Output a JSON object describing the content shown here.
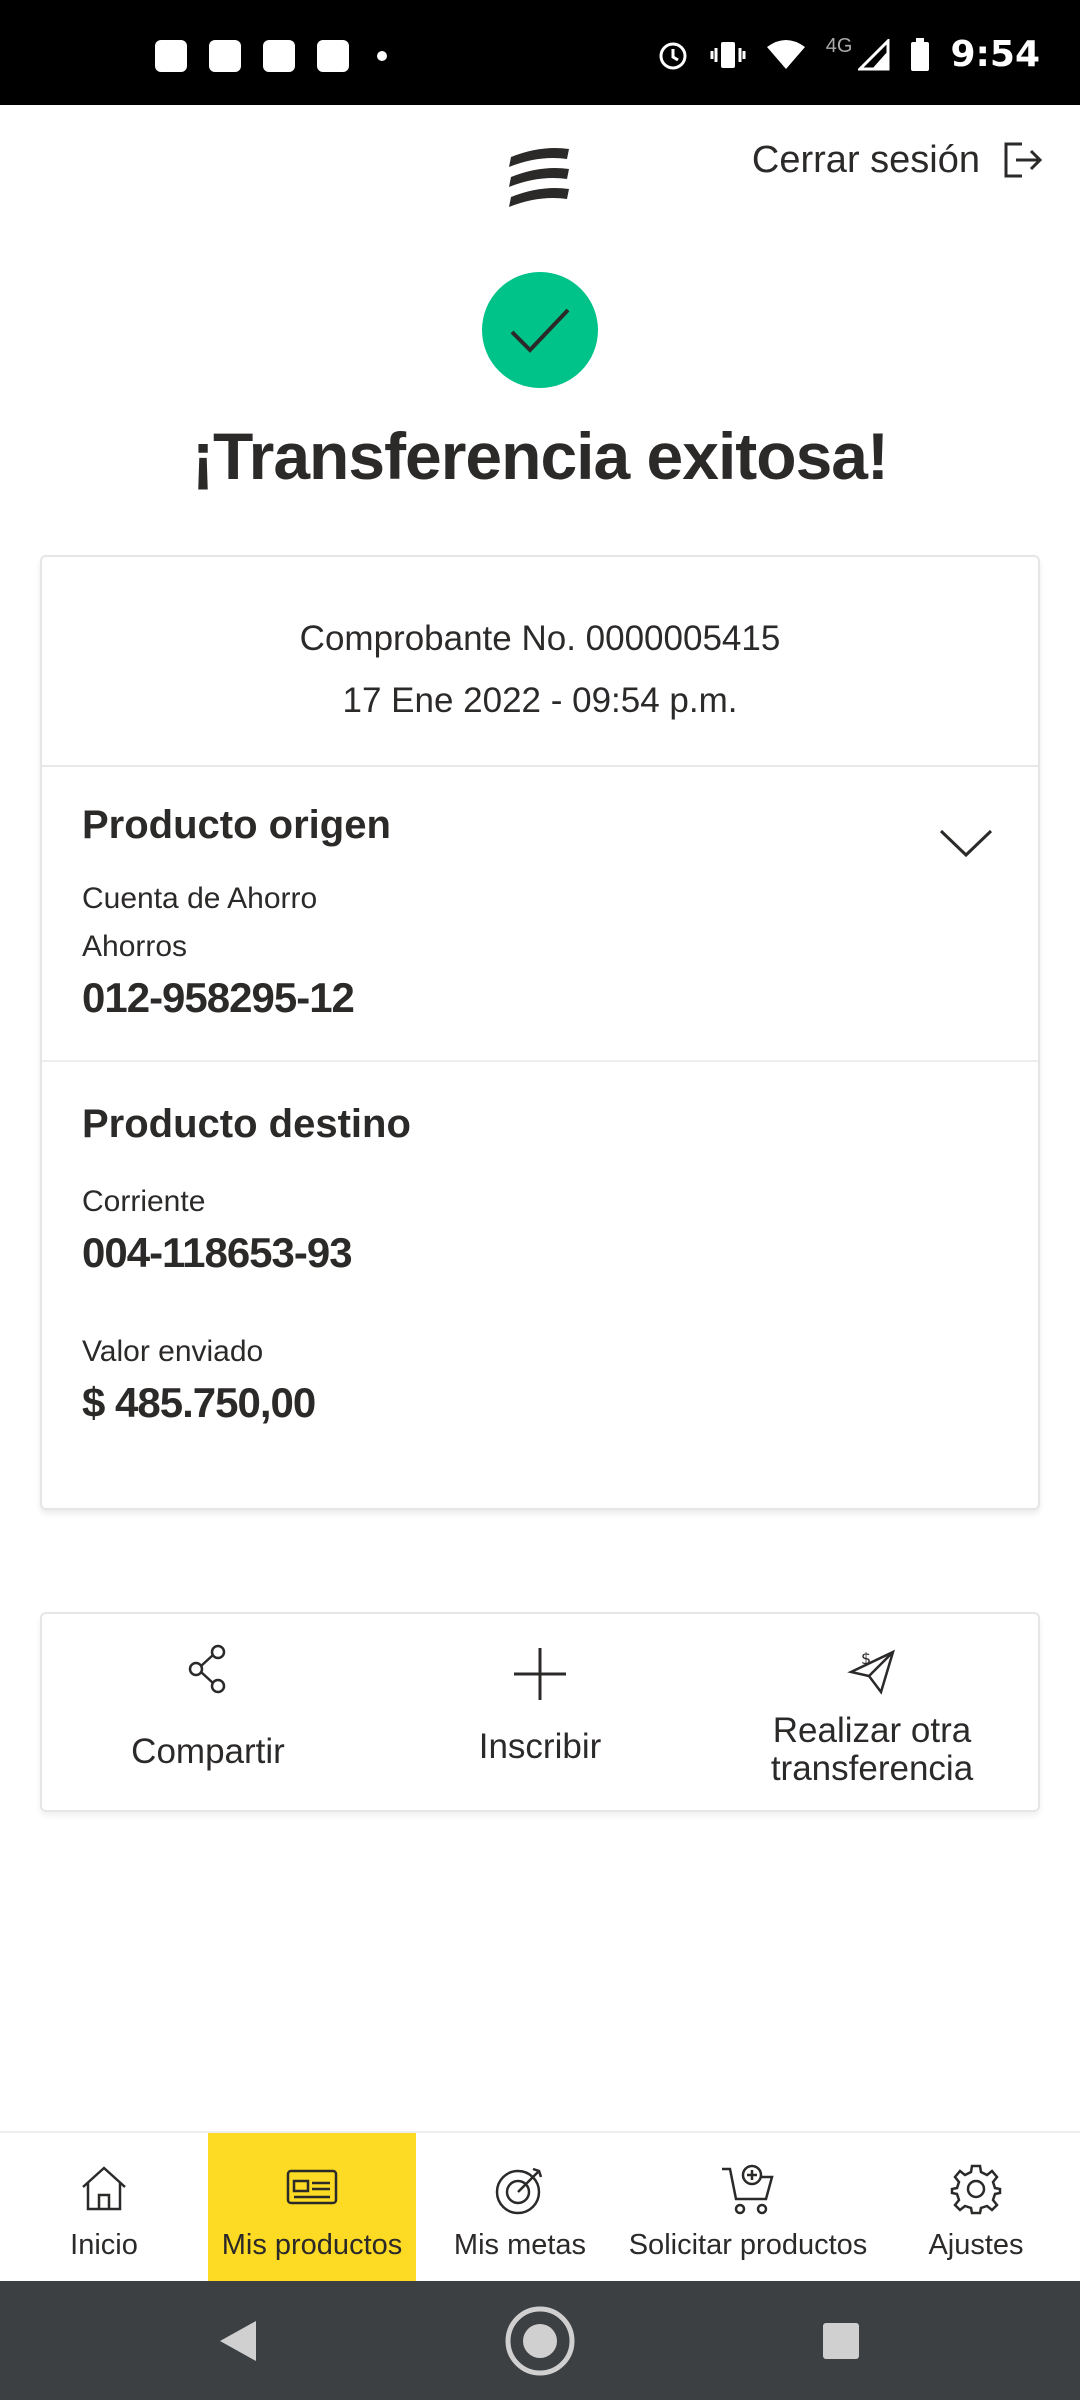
{
  "status_bar": {
    "time": "9:54",
    "network": "4G"
  },
  "header": {
    "logout_label": "Cerrar sesión"
  },
  "title": "¡Transferencia exitosa!",
  "receipt": {
    "number": "Comprobante No. 0000005415",
    "date": "17 Ene 2022 - 09:54 p.m."
  },
  "origin": {
    "heading": "Producto origen",
    "type": "Cuenta de Ahorro",
    "subtype": "Ahorros",
    "account": "012-958295-12"
  },
  "destination": {
    "heading": "Producto destino",
    "type": "Corriente",
    "account": "004-118653-93",
    "amount_label": "Valor enviado",
    "amount": "$ 485.750,00"
  },
  "actions": {
    "share": "Compartir",
    "enroll": "Inscribir",
    "another_line1": "Realizar otra",
    "another_line2": "transferencia"
  },
  "bottom_nav": {
    "items": [
      {
        "label": "Inicio",
        "icon": "home-icon"
      },
      {
        "label": "Mis productos",
        "icon": "card-icon",
        "active": true
      },
      {
        "label": "Mis metas",
        "icon": "target-icon"
      },
      {
        "label": "Solicitar productos",
        "icon": "cart-plus-icon"
      },
      {
        "label": "Ajustes",
        "icon": "gear-icon"
      }
    ]
  },
  "colors": {
    "success": "#00c389",
    "active_nav": "#fdda24",
    "text": "#2c2a29"
  }
}
